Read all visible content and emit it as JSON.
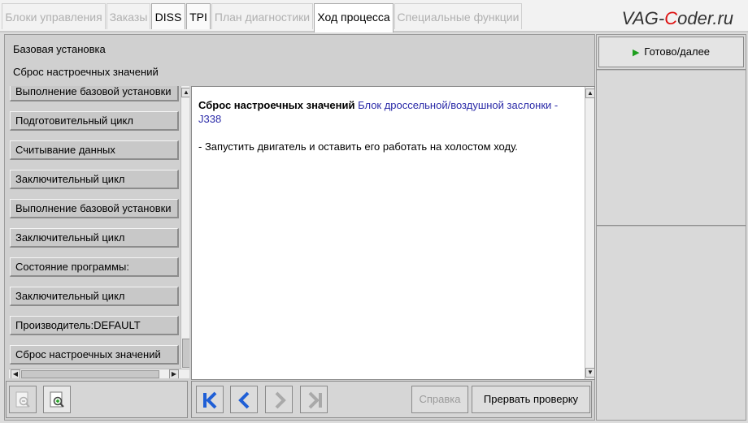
{
  "tabs": [
    {
      "label": "Блоки управления",
      "state": "disabled"
    },
    {
      "label": "Заказы",
      "state": "disabled"
    },
    {
      "label": "DISS",
      "state": "enabled"
    },
    {
      "label": "TPI",
      "state": "enabled"
    },
    {
      "label": "План диагностики",
      "state": "disabled"
    },
    {
      "label": "Ход процесса",
      "state": "active"
    },
    {
      "label": "Специальные функции",
      "state": "disabled"
    }
  ],
  "watermark": {
    "part1": "VAG-",
    "part2": "C",
    "part3": "oder.ru"
  },
  "header": {
    "line1": "Базовая установка",
    "line2": "Сброс настроечных значений"
  },
  "steps": [
    "Выполнение базовой установки",
    "Подготовительный цикл",
    "Считывание данных",
    "Заключительный цикл",
    "Выполнение базовой установки",
    "Заключительный цикл",
    "Состояние программы:",
    "Заключительный цикл",
    "Производитель:DEFAULT",
    "Сброс настроечных значений"
  ],
  "content": {
    "title": "Сброс настроечных значений",
    "link": "Блок дроссельной/воздушной заслонки - J338",
    "instruction": "- Запустить двигатель и оставить его работать на холостом ходу."
  },
  "right_panel": {
    "ready_label": "Готово/далее"
  },
  "toolbar": {
    "help_label": "Справка",
    "abort_label": "Прервать проверку"
  },
  "icons": {
    "zoom_out": "zoom-out-icon",
    "zoom_in": "zoom-in-icon",
    "first": "skip-to-first-icon",
    "back": "chevron-left-icon",
    "forward": "chevron-right-icon",
    "last": "skip-to-last-icon",
    "play": "play-icon"
  },
  "colors": {
    "link": "#2a2aa8",
    "nav_active": "#1f5fd6",
    "play": "#1d9e1d",
    "watermark_accent": "#dd1111"
  }
}
